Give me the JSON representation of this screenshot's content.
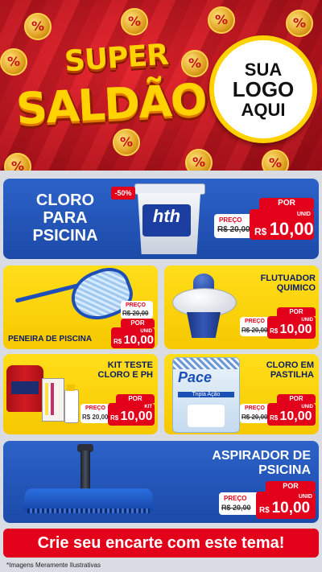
{
  "hero": {
    "title_line1": "SUPER",
    "title_line2": "SALDÃO",
    "logo_line1": "SUA",
    "logo_line2": "LOGO",
    "logo_line3": "AQUI",
    "coin_symbol": "%"
  },
  "products": [
    {
      "name": "CLORO PARA PSICINA",
      "name_lines": [
        "CLORO",
        "PARA",
        "PSICINA"
      ],
      "badge": "-50%",
      "old_label": "PREÇO",
      "old_value": "R$ 20,00",
      "por_label": "POR",
      "unit": "UNID",
      "currency": "R$",
      "new_value": "10,00",
      "product_brand": "hth"
    },
    {
      "name": "PENEIRA DE PISCINA",
      "old_label": "PREÇO",
      "old_value": "R$ 20,00",
      "por_label": "POR",
      "unit": "UNID",
      "currency": "R$",
      "new_value": "10,00"
    },
    {
      "name_lines": [
        "FLUTUADOR",
        "QUIMICO"
      ],
      "old_label": "PREÇO",
      "old_value": "R$ 20,00",
      "por_label": "POR",
      "unit": "UNID",
      "currency": "R$",
      "new_value": "10,00"
    },
    {
      "name_lines": [
        "KIT TESTE",
        "CLORO E PH"
      ],
      "old_label": "PREÇO",
      "old_value": "R$ 20,00",
      "por_label": "POR",
      "unit": "KIT",
      "currency": "R$",
      "new_value": "10,00"
    },
    {
      "name_lines": [
        "CLORO EM",
        "PASTILHA"
      ],
      "old_label": "PREÇO",
      "old_value": "R$ 20,00",
      "por_label": "POR",
      "unit": "UNID",
      "currency": "R$",
      "new_value": "10,00",
      "product_brand": "Pace",
      "product_sub": "Tripla Ação"
    },
    {
      "name_lines": [
        "ASPIRADOR DE",
        "PSICINA"
      ],
      "old_label": "PREÇO",
      "old_value": "R$ 20,00",
      "por_label": "POR",
      "unit": "UNID",
      "currency": "R$",
      "new_value": "10,00"
    }
  ],
  "footer": {
    "cta": "Crie seu encarte com este tema!",
    "disclaimer": "*Imagens Meramente Ilustrativas"
  },
  "colors": {
    "red": "#e3001b",
    "blue": "#2c62c9",
    "yellow": "#ffd200"
  }
}
